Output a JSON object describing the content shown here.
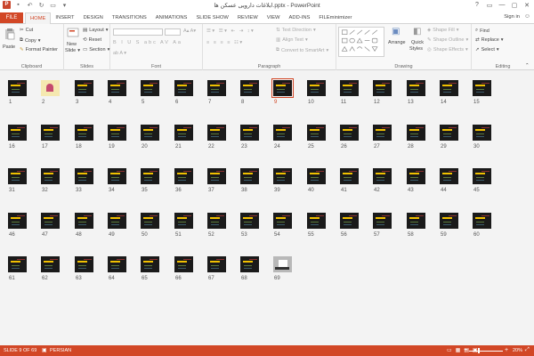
{
  "window": {
    "app_letter": "P",
    "title": "ابلاغات دارویی عسکن ها.pptx - PowerPoint",
    "controls": [
      "?",
      "▭",
      "—",
      "▢",
      "✕"
    ]
  },
  "tabs": {
    "file": "FILE",
    "items": [
      "HOME",
      "INSERT",
      "DESIGN",
      "TRANSITIONS",
      "ANIMATIONS",
      "SLIDE SHOW",
      "REVIEW",
      "VIEW",
      "ADD-INS",
      "FILEminimizer"
    ],
    "active": "HOME",
    "signin": "Sign in"
  },
  "ribbon": {
    "clipboard": {
      "label": "Clipboard",
      "paste": "Paste",
      "cut": "Cut",
      "copy": "Copy",
      "format_painter": "Format Painter"
    },
    "slides": {
      "label": "Slides",
      "new_slide": "New",
      "new_slide2": "Slide",
      "layout": "Layout",
      "reset": "Reset",
      "section": "Section"
    },
    "font": {
      "label": "Font"
    },
    "paragraph": {
      "label": "Paragraph",
      "text_direction": "Text Direction",
      "align_text": "Align Text",
      "convert": "Convert to SmartArt"
    },
    "drawing": {
      "label": "Drawing",
      "arrange": "Arrange",
      "quick_styles": "Quick",
      "quick_styles2": "Styles",
      "shape_fill": "Shape Fill",
      "shape_outline": "Shape Outline",
      "shape_effects": "Shape Effects"
    },
    "editing": {
      "label": "Editing",
      "find": "Find",
      "replace": "Replace",
      "select": "Select"
    }
  },
  "sorter": {
    "selected_slide": 9,
    "special_slides": {
      "title": 2,
      "photo": 69
    },
    "slides": [
      "1",
      "2",
      "3",
      "4",
      "5",
      "6",
      "7",
      "8",
      "9",
      "10",
      "11",
      "12",
      "13",
      "14",
      "15",
      "16",
      "17",
      "18",
      "19",
      "20",
      "21",
      "22",
      "23",
      "24",
      "25",
      "26",
      "27",
      "28",
      "29",
      "30",
      "31",
      "32",
      "33",
      "34",
      "35",
      "36",
      "37",
      "38",
      "39",
      "40",
      "41",
      "42",
      "43",
      "44",
      "45",
      "46",
      "47",
      "48",
      "49",
      "50",
      "51",
      "52",
      "53",
      "54",
      "55",
      "56",
      "57",
      "58",
      "59",
      "60",
      "61",
      "62",
      "63",
      "64",
      "65",
      "66",
      "67",
      "68",
      "69"
    ]
  },
  "status": {
    "slide_info": "SLIDE 9 OF 69",
    "language": "PERSIAN",
    "zoom": "20%"
  },
  "colors": {
    "accent": "#d24726"
  }
}
